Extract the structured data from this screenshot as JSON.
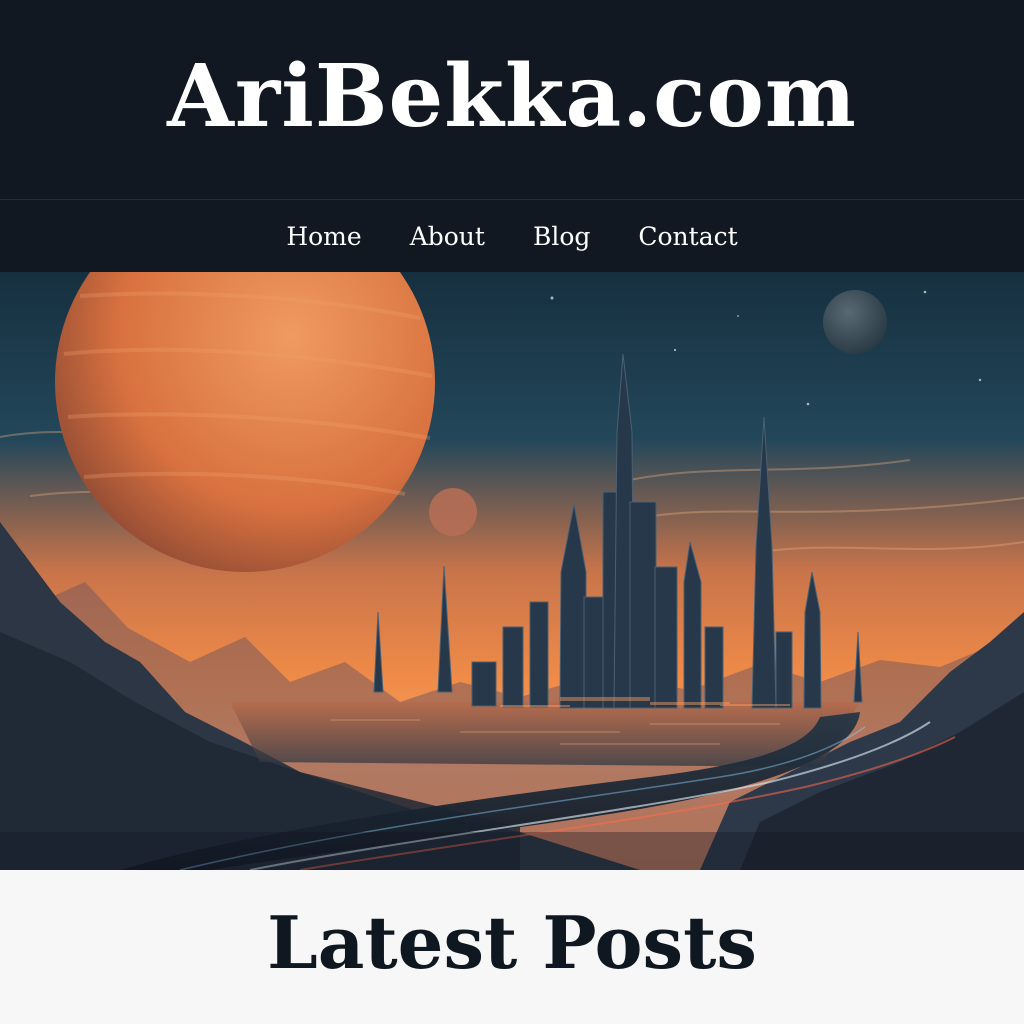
{
  "site": {
    "title": "AriBekka.com"
  },
  "nav": {
    "items": [
      {
        "label": "Home"
      },
      {
        "label": "About"
      },
      {
        "label": "Blog"
      },
      {
        "label": "Contact"
      }
    ]
  },
  "hero": {
    "icon": "sci-fi-city-landscape-illustration",
    "colors": {
      "sky_top": "#17303f",
      "sky_glow": "#f28a4a",
      "planet": "#d97a45",
      "mountains": "#2b3442"
    }
  },
  "content": {
    "section_title": "Latest Posts"
  },
  "colors": {
    "header_bg": "#111821",
    "text_light": "#ffffff",
    "content_bg": "#f7f7f7",
    "text_dark": "#0f1720"
  }
}
